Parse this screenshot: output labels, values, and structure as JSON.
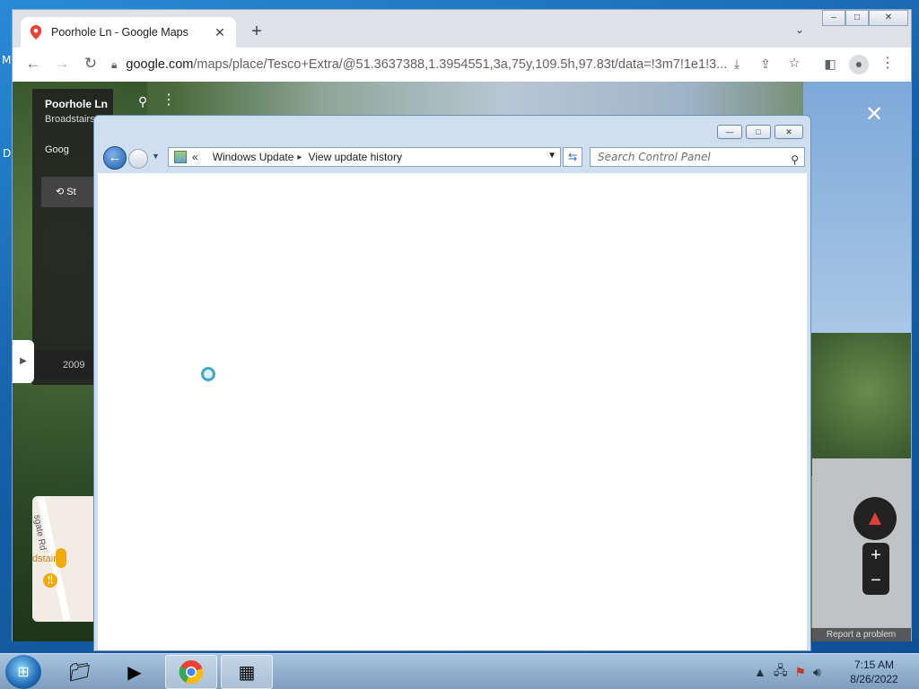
{
  "browser": {
    "tab_title": "Poorhole Ln - Google Maps",
    "tab_close": "✕",
    "new_tab": "+",
    "tab_menu": "⌄",
    "url_host": "google.com",
    "url_path": "/maps/place/Tesco+Extra/@51.3637388,1.3954551,3a,75y,109.5h,97.83t/data=!3m7!1e1!3...",
    "win_min": "–",
    "win_max": "□",
    "win_close": "✕",
    "icons": [
      "back-icon",
      "forward-icon",
      "reload-icon",
      "lock-icon",
      "install-icon",
      "share-icon",
      "star-icon",
      "side-panel-icon",
      "profile-icon",
      "menu-icon"
    ]
  },
  "streetview": {
    "street": "Poorhole Ln",
    "town": "Broadstairs",
    "gmaps": "Goog",
    "history_label": "St",
    "year": "2009",
    "close": "✕",
    "report": "Report a problem",
    "zoom_in": "+",
    "zoom_out": "−",
    "minimap": {
      "road_label": "sgate Rd",
      "place_label": "dstairs"
    }
  },
  "control_panel": {
    "breadcrumb_prefix": "«",
    "breadcrumb_1": "Windows Update",
    "breadcrumb_sep": "▸",
    "breadcrumb_2": "View update history",
    "search_placeholder": "Search Control Panel",
    "btn_min": "—",
    "btn_max": "□",
    "btn_close": "✕"
  },
  "desktop": {
    "glyph_1": "M",
    "glyph_2": "D"
  },
  "taskbar": {
    "time": "7:15 AM",
    "date": "8/26/2022",
    "items": [
      "explorer-icon",
      "media-player-icon",
      "chrome-icon",
      "control-panel-icon"
    ]
  }
}
